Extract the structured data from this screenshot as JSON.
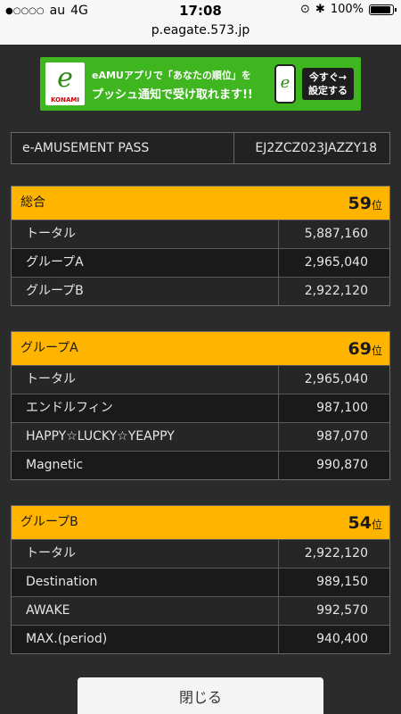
{
  "status_bar": {
    "signal": "●○○○○",
    "carrier": "au",
    "network": "4G",
    "time": "17:08",
    "battery": "100%",
    "battery_level": 1.0,
    "url": "p.eagate.573.jp"
  },
  "banner": {
    "logo_brand": "KONAMI",
    "line1": "eAMUアプリで「あなたの順位」を",
    "line2": "プッシュ通知で受け取れます!!",
    "button_line1": "今すぐ→",
    "button_line2": "設定する"
  },
  "pass": {
    "label": "e-AMUSEMENT PASS",
    "value": "EJ2ZCZ023JAZZY18"
  },
  "rank_unit": "位",
  "sections": [
    {
      "title": "総合",
      "rank": "59",
      "rows": [
        {
          "name": "トータル",
          "score": "5,887,160"
        },
        {
          "name": "グループA",
          "score": "2,965,040"
        },
        {
          "name": "グループB",
          "score": "2,922,120"
        }
      ]
    },
    {
      "title": "グループA",
      "rank": "69",
      "rows": [
        {
          "name": "トータル",
          "score": "2,965,040"
        },
        {
          "name": "エンドルフィン",
          "score": "987,100"
        },
        {
          "name": "HAPPY☆LUCKY☆YEAPPY",
          "score": "987,070"
        },
        {
          "name": "Magnetic",
          "score": "990,870"
        }
      ]
    },
    {
      "title": "グループB",
      "rank": "54",
      "rows": [
        {
          "name": "トータル",
          "score": "2,922,120"
        },
        {
          "name": "Destination",
          "score": "989,150"
        },
        {
          "name": "AWAKE",
          "score": "992,570"
        },
        {
          "name": "MAX.(period)",
          "score": "940,400"
        }
      ]
    }
  ],
  "close_label": "閉じる"
}
